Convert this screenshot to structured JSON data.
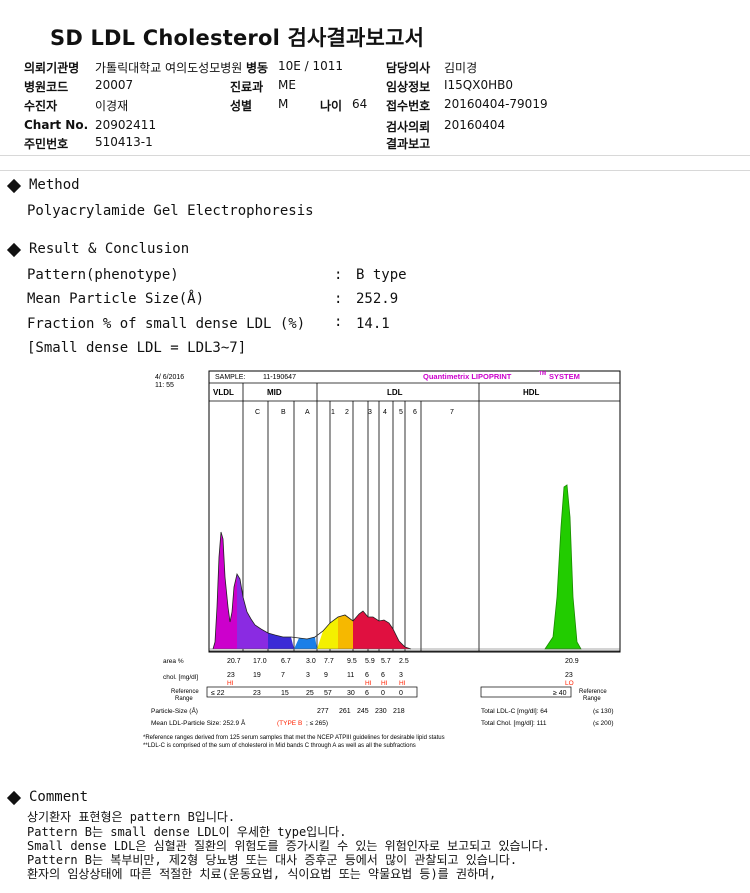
{
  "title": "SD LDL Cholesterol 검사결과보고서",
  "header": {
    "hospital_label": "의뢰기관명",
    "hospital_value": "가톨릭대학교 여의도성모병원",
    "ward_label": "병동",
    "ward_value": "10E / 1011",
    "doctor_label": "담당의사",
    "doctor_value": "김미경",
    "code_label": "병원코드",
    "code_value": "20007",
    "dept_label": "진료과",
    "dept_value": "ME",
    "clinical_label": "임상정보",
    "clinical_value": "I15QX0HB0",
    "patient_label": "수진자",
    "patient_value": "이경재",
    "sex_label": "성별",
    "sex_value": "M",
    "age_label": "나이",
    "age_value": "64",
    "receipt_label": "접수번호",
    "receipt_value": "20160404-79019",
    "chart_label": "Chart No.",
    "chart_value": "20902411",
    "request_label": "검사의뢰",
    "request_value": "20160404",
    "id_label": "주민번호",
    "id_value": "510413-1",
    "result_label": "결과보고",
    "result_value": ""
  },
  "method": {
    "heading": "Method",
    "text": "Polyacrylamide Gel Electrophoresis"
  },
  "result": {
    "heading": "Result & Conclusion",
    "pattern_label": "Pattern(phenotype)",
    "pattern_value": "B type",
    "size_label": "Mean Particle Size(Å)",
    "size_value": "252.9",
    "fraction_label": "Fraction % of small dense LDL (%)",
    "fraction_value": "14.1",
    "note": "[Small dense LDL = LDL3~7]",
    "colon": ":"
  },
  "report": {
    "date": "4/ 6/2016",
    "time": "11: 55",
    "sample_label": "SAMPLE:",
    "sample_value": "11-190647",
    "brand": "Quantimetrix LIPOPRINT",
    "brand_tm": "TM",
    "brand_suffix": "SYSTEM",
    "band_vldl": "VLDL",
    "band_mid": "MID",
    "band_ldl": "LDL",
    "band_hdl": "HDL",
    "sub_labels": [
      "C",
      "B",
      "A",
      "1",
      "2",
      "3",
      "4",
      "5",
      "6",
      "7"
    ],
    "area_label": "area %",
    "area_values": [
      "20.7",
      "17.0",
      "6.7",
      "3.0",
      "7.7",
      "9.5",
      "5.9",
      "5.7",
      "2.5"
    ],
    "area_hdl": "20.9",
    "chol_label": "chol. [mg/dl]",
    "chol_values": [
      "23",
      "19",
      "7",
      "3",
      "9",
      "11",
      "6",
      "6",
      "3"
    ],
    "chol_hdl": "23",
    "flags": [
      "HI",
      "HI",
      "HI",
      "HI"
    ],
    "flag_hdl": "LO",
    "ref_label_left": [
      "Reference",
      "Range"
    ],
    "ref_values": [
      "≤ 22",
      "23",
      "15",
      "25",
      "57",
      "30",
      "6",
      "0",
      "0"
    ],
    "ref_hdl": "≥ 40",
    "ref_label_right": [
      "Reference",
      "Range"
    ],
    "particle_label": "Particle-Size (Å)",
    "particle_values": [
      "277",
      "261",
      "245",
      "230",
      "218"
    ],
    "total_ldl_label": "Total LDL-C [mg/dl]:  64",
    "total_ldl_ref": "(≤ 130)",
    "mean_label": "Mean LDL-Particle Size:  252.9 Å",
    "type_tag": "(TYPE B",
    "type_ref": "; ≤ 265)",
    "total_chol_label": "Total Chol. [mg/dl]:  111",
    "total_chol_ref": "(≤ 200)",
    "foot1": "*Reference ranges derived from 125 serum samples that met the NCEP ATPIII guidelines for desirable lipid status",
    "foot2": "**LDL-C is comprised of the sum of cholesterol in Mid bands C through A as well as all the subfractions"
  },
  "comment": {
    "heading": "Comment",
    "lines": [
      "상기환자 표현형은 pattern B입니다.",
      "Pattern B는 small dense LDL이 우세한 type입니다.",
      "Small dense LDL은 심혈관 질환의 위험도를 증가시킬 수 있는 위험인자로 보고되고 있습니다.",
      "Pattern B는 복부비만, 제2형 당뇨병 또는 대사 증후군 등에서 많이 관찰되고 있습니다.",
      "환자의 임상상태에 따른 적절한 치료(운동요법, 식이요법 또는 약물요법 등)를 권하며,"
    ]
  },
  "colors": {
    "vldl": "#cc00cc",
    "mid_c": "#8a2be2",
    "mid_b": "#3b2bd6",
    "mid_a": "#1a7fe8",
    "ldl1": "#f4f000",
    "ldl2": "#f6b800",
    "ldl3": "#e01040",
    "ldl4": "#e01040",
    "hdl": "#22cc00",
    "brand": "#cc00cc",
    "flag": "#ff2200"
  }
}
